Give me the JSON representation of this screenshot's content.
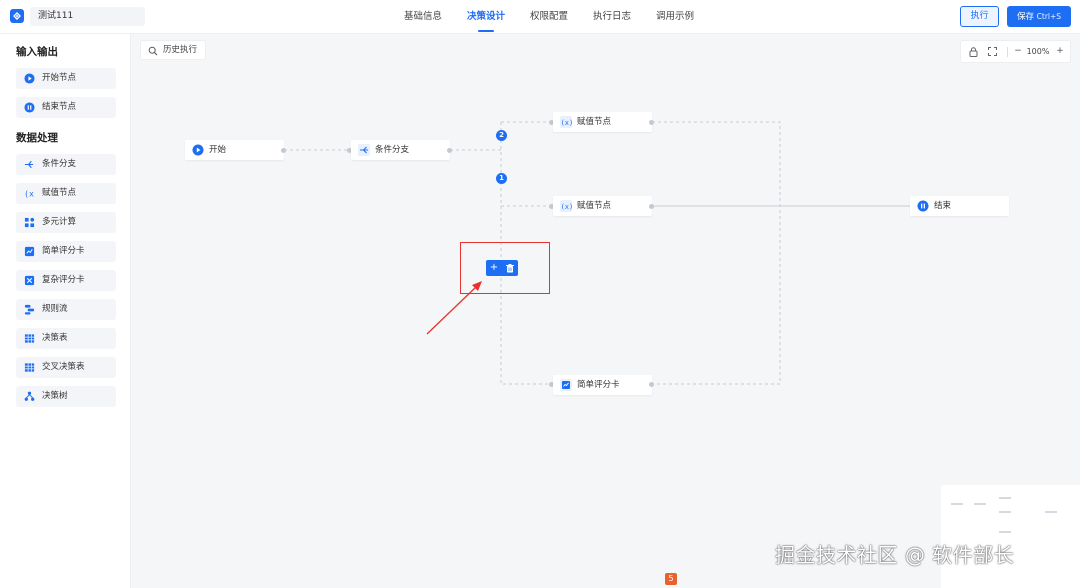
{
  "header": {
    "project_name": "测试111",
    "tabs": [
      {
        "label": "基础信息"
      },
      {
        "label": "决策设计"
      },
      {
        "label": "权限配置"
      },
      {
        "label": "执行日志"
      },
      {
        "label": "调用示例"
      }
    ],
    "run_label": "执行",
    "save_label": "保存",
    "save_shortcut": "Ctrl+S"
  },
  "sidebar": {
    "sections": [
      {
        "title": "输入输出",
        "items": [
          {
            "label": "开始节点",
            "icon": "play-circle-icon"
          },
          {
            "label": "结束节点",
            "icon": "pause-circle-icon"
          }
        ]
      },
      {
        "title": "数据处理",
        "items": [
          {
            "label": "条件分支",
            "icon": "branch-icon"
          },
          {
            "label": "赋值节点",
            "icon": "assign-icon"
          },
          {
            "label": "多元计算",
            "icon": "calc-grid-icon"
          },
          {
            "label": "简单评分卡",
            "icon": "scorecard-icon"
          },
          {
            "label": "复杂评分卡",
            "icon": "complex-scorecard-icon"
          },
          {
            "label": "规则流",
            "icon": "rule-flow-icon"
          },
          {
            "label": "决策表",
            "icon": "table-icon"
          },
          {
            "label": "交叉决策表",
            "icon": "cross-table-icon"
          },
          {
            "label": "决策树",
            "icon": "tree-icon"
          }
        ]
      }
    ]
  },
  "canvas": {
    "history_label": "历史执行",
    "zoom": "100%",
    "nodes": {
      "start": "开始",
      "branch": "条件分支",
      "assign_top": "赋值节点",
      "assign_mid": "赋值节点",
      "end": "结束",
      "scorecard": "简单评分卡"
    },
    "badges": {
      "top": "2",
      "mid": "1"
    },
    "edge_toolbar": {
      "add": "+",
      "delete": "delete-icon"
    }
  },
  "watermark": "掘金技术社区 @ 软件部长",
  "colors": {
    "primary": "#1e6ef4",
    "highlight": "#e8322f",
    "canvas_bg": "#f5f6f8"
  }
}
